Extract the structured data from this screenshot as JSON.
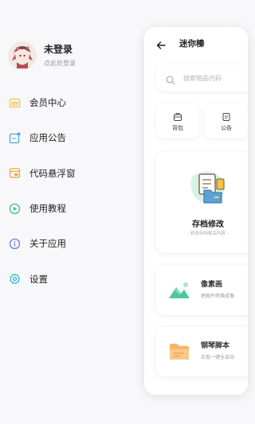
{
  "profile": {
    "name": "未登录",
    "subtitle": "点此处登录"
  },
  "drawer_menu": [
    {
      "label": "会员中心",
      "icon": "crown-icon",
      "color": "#f5c242"
    },
    {
      "label": "应用公告",
      "icon": "announcement-icon",
      "color": "#4aa8e0"
    },
    {
      "label": "代码悬浮窗",
      "icon": "floating-window-icon",
      "color": "#f0a43c"
    },
    {
      "label": "使用教程",
      "icon": "play-circle-icon",
      "color": "#3dbf7f"
    },
    {
      "label": "关于应用",
      "icon": "info-icon",
      "color": "#6a7fe0"
    },
    {
      "label": "设置",
      "icon": "gear-icon",
      "color": "#27b3c9"
    }
  ],
  "panel": {
    "title": "迷你榛",
    "search_placeholder": "搜索物品代码",
    "quick_actions": [
      {
        "label": "背包",
        "icon": "backpack-icon"
      },
      {
        "label": "公告",
        "icon": "notice-icon"
      }
    ],
    "archive_card": {
      "title": "存档修改",
      "subtitle": "- 修改存档相关内容 -"
    },
    "feature_cards": [
      {
        "title": "像素画",
        "subtitle": "把图片转换成像",
        "icon": "mountain-image-icon",
        "color": "#4cc79a"
      },
      {
        "title": "钢琴脚本",
        "subtitle": "实现一键全自动",
        "icon": "folder-icon",
        "color": "#f5b66a"
      }
    ]
  }
}
